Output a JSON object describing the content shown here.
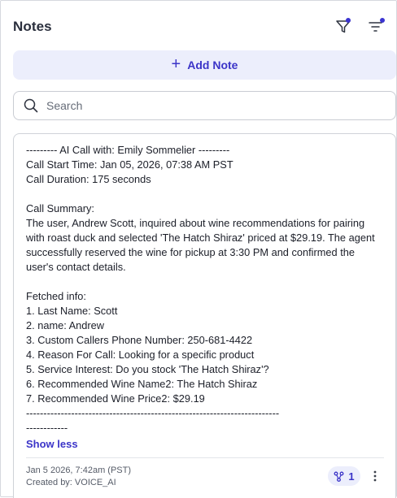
{
  "header": {
    "title": "Notes",
    "filter_icon": "filter-icon",
    "sort_icon": "sort-icon"
  },
  "add_note": {
    "label": "Add Note",
    "icon": "plus-icon"
  },
  "search": {
    "placeholder": "Search",
    "value": "",
    "icon": "search-icon"
  },
  "note": {
    "lines": [
      "--------- AI Call with: Emily Sommelier ---------",
      "Call Start Time: Jan 05, 2026, 07:38 AM PST",
      "Call Duration: 175 seconds",
      "",
      "Call Summary:",
      "The user, Andrew Scott, inquired about wine recommendations for pairing",
      "with roast duck and selected 'The Hatch Shiraz' priced at $29.19. The agent",
      "successfully reserved the wine for pickup at 3:30 PM and confirmed the",
      "user's contact details.",
      "",
      "Fetched info:",
      "1. Last Name: Scott",
      "2. name: Andrew",
      "3. Custom Callers Phone Number: 250-681-4422",
      "4. Reason For Call: Looking for a specific product",
      "5. Service Interest: Do you stock 'The Hatch Shiraz'?",
      "6. Recommended Wine Name2: The Hatch Shiraz",
      "7. Recommended Wine Price2: $29.19",
      "-------------------------------------------------------------------------",
      "------------"
    ],
    "show_less": "Show less",
    "date": "Jan 5 2026, 7:42am (PST)",
    "created_by": "Created by: VOICE_AI",
    "association_count": "1",
    "association_icon": "association-icon",
    "more_icon": "more-vertical-icon"
  },
  "colors": {
    "accent": "#3b34c8",
    "accent_bg": "#eceefc",
    "indicator_dot": "#3b34d1"
  }
}
